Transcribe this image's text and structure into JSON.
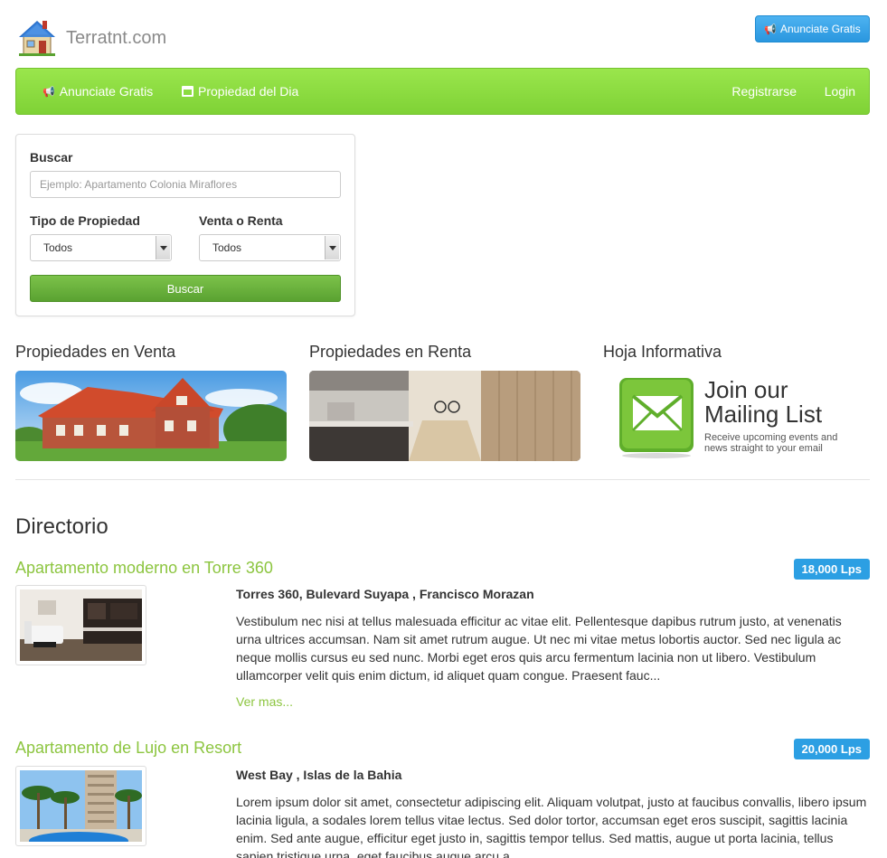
{
  "header": {
    "brand": "Terratnt.com",
    "cta_label": "Anunciate Gratis"
  },
  "navbar": {
    "item1": "Anunciate Gratis",
    "item2": "Propiedad del Dia",
    "item3": "Registrarse",
    "item4": "Login"
  },
  "search": {
    "label_search": "Buscar",
    "placeholder": "Ejemplo: Apartamento Colonia Miraflores",
    "label_type": "Tipo de Propiedad",
    "label_mode": "Venta o Renta",
    "type_value": "Todos",
    "mode_value": "Todos",
    "button": "Buscar"
  },
  "features": {
    "sale_title": "Propiedades en Venta",
    "rent_title": "Propiedades en Renta",
    "newsletter_title": "Hoja Informativa",
    "mailing_line1": "Join our",
    "mailing_line2": "Mailing List",
    "mailing_sub1": "Receive upcoming events and",
    "mailing_sub2": "news straight to your email"
  },
  "directory": {
    "title": "Directorio",
    "listings": [
      {
        "title": "Apartamento moderno en Torre 360",
        "price": "18,000 Lps",
        "address": "Torres 360, Bulevard Suyapa , Francisco Morazan",
        "description": "Vestibulum nec nisi at tellus malesuada efficitur ac vitae elit. Pellentesque dapibus rutrum justo, at venenatis urna ultrices accumsan. Nam sit amet rutrum augue. Ut nec mi vitae metus lobortis auctor. Sed nec ligula ac neque mollis cursus eu sed nunc. Morbi eget eros quis arcu fermentum lacinia non ut libero. Vestibulum ullamcorper velit quis enim dictum, id aliquet quam congue. Praesent fauc...",
        "more": "Ver mas..."
      },
      {
        "title": "Apartamento de Lujo en Resort",
        "price": "20,000 Lps",
        "address": "West Bay , Islas de la Bahia",
        "description": "Lorem ipsum dolor sit amet, consectetur adipiscing elit. Aliquam volutpat, justo at faucibus convallis, libero ipsum lacinia ligula, a sodales lorem tellus vitae lectus. Sed dolor tortor, accumsan eget eros suscipit, sagittis lacinia enim. Sed ante augue, efficitur eget justo in, sagittis tempor tellus. Sed mattis, augue ut porta lacinia, tellus sapien tristique urna, eget faucibus augue arcu a..."
      }
    ]
  },
  "colors": {
    "nav_green": "#8cdc40",
    "link_green": "#8cc53f",
    "badge_blue": "#2c9fe3"
  }
}
